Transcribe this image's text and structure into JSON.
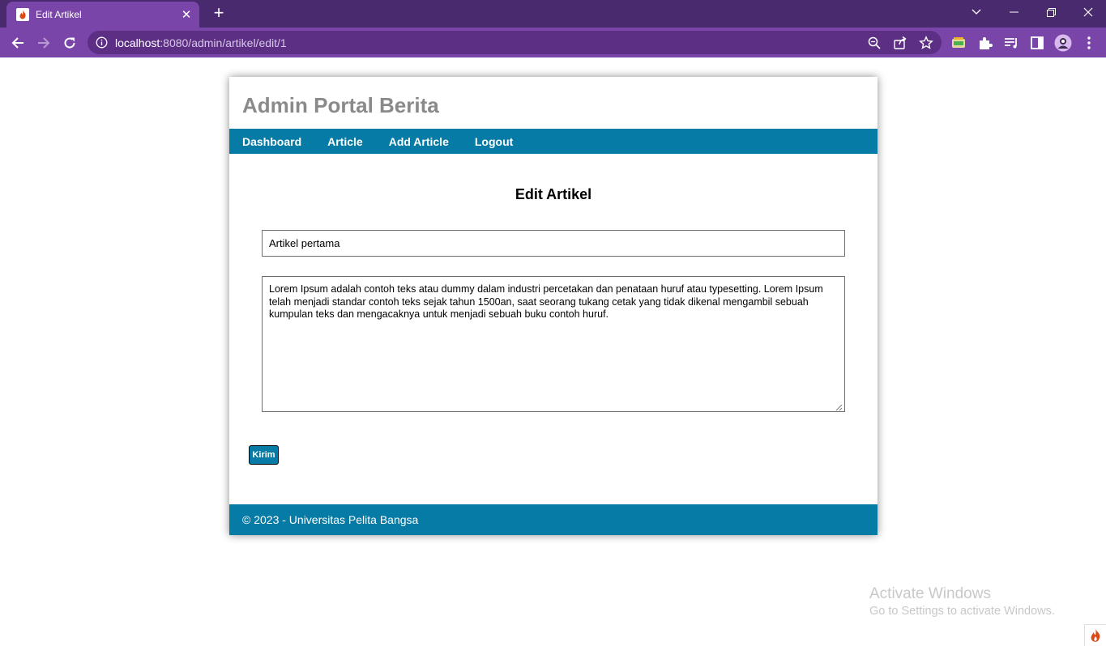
{
  "browser": {
    "tab_title": "Edit Artikel",
    "tab_close": "✕",
    "new_tab": "+",
    "url_host": "localhost",
    "url_rest": ":8080/admin/artikel/edit/1",
    "window_controls": {
      "dropdown": "⌵",
      "minimize": "—",
      "restore": "❐",
      "close": "✕"
    },
    "colors": {
      "titlebar": "#4a2a6e",
      "toolbar": "#7a45a8",
      "omnibox": "#5c2f85"
    }
  },
  "site": {
    "title": "Admin Portal Berita",
    "nav": [
      {
        "label": "Dashboard"
      },
      {
        "label": "Article"
      },
      {
        "label": "Add Article"
      },
      {
        "label": "Logout"
      }
    ],
    "accent_color": "#067ba5"
  },
  "form": {
    "heading": "Edit Artikel",
    "title_value": "Artikel pertama",
    "body_value": "Lorem Ipsum adalah contoh teks atau dummy dalam industri percetakan dan penataan huruf atau typesetting. Lorem Ipsum telah menjadi standar contoh teks sejak tahun 1500an, saat seorang tukang cetak yang tidak dikenal mengambil sebuah kumpulan teks dan mengacaknya untuk menjadi sebuah buku contoh huruf.",
    "submit_label": "Kirim"
  },
  "footer": {
    "text": "© 2023 - Universitas Pelita Bangsa"
  },
  "os_watermark": {
    "line1": "Activate Windows",
    "line2": "Go to Settings to activate Windows."
  }
}
